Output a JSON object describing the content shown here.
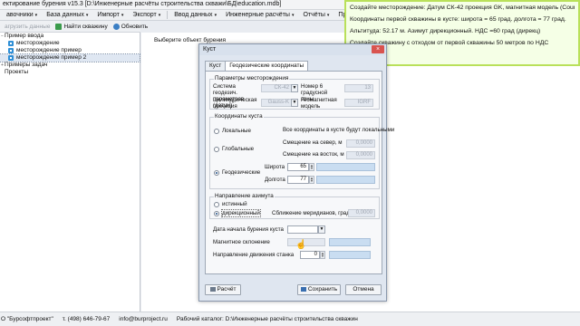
{
  "window": {
    "title": "ектирование бурения v15.3 [D:\\Инженерные расчёты строительства скважи\\БД\\education.mdb]"
  },
  "menu": [
    {
      "label": "авочники",
      "caret": "▾"
    },
    {
      "label": "База данных",
      "caret": "▾"
    },
    {
      "label": "Импорт",
      "caret": "▾"
    },
    {
      "label": "Экспорт",
      "caret": "▾"
    },
    {
      "label": "Ввод данных",
      "caret": "▾"
    },
    {
      "label": "Инженерные расчёты",
      "caret": "▾"
    },
    {
      "label": "Отчёты",
      "caret": "▾"
    },
    {
      "label": "Проект на строительс",
      "caret": ""
    }
  ],
  "toolbar": {
    "unload_label": "агрузить данные",
    "find_well_label": "Найти скважину",
    "refresh_label": "Обновить"
  },
  "tree": {
    "items": [
      {
        "label": "Пример ввода",
        "level": 0,
        "toggle": "−",
        "icon": false
      },
      {
        "label": "месторождение",
        "level": 1,
        "toggle": "",
        "icon": true
      },
      {
        "label": "месторождение пример",
        "level": 1,
        "toggle": "",
        "icon": true
      },
      {
        "label": "месторождение пример 2",
        "level": 1,
        "toggle": "",
        "icon": true,
        "selected": true
      },
      {
        "label": "Примеры задач",
        "level": 0,
        "toggle": "+",
        "icon": false
      },
      {
        "label": "Проекты",
        "level": 0,
        "toggle": "",
        "icon": false
      }
    ]
  },
  "main": {
    "prompt": "Выберите объект бурения"
  },
  "status": {
    "company": "О \"Бурсофтпроект\"",
    "phone": "т. (498) 646-79-67",
    "email": "info@burproject.ru",
    "workdir": "Рабочий каталог: D:\\Инженерные расчёты строительства скважин"
  },
  "note": {
    "lines": [
      "Создайте месторождение: Датум СК-42 проекция GK, магнитная модель (Country)",
      "Координаты первой скважины в кусте: широта = 65 град.  долгота = 77 град.",
      "Альтитуда: 52.17 м. Азимут дирекционный. НДС =60 град (дирекц)",
      "Создайте скважину с отходом от первой скважины 50 метров по НДС"
    ]
  },
  "dialog": {
    "title": "Куст",
    "close_icon": "×",
    "tabs": [
      "Куст",
      "Геодезические координаты"
    ],
    "params_group": {
      "title": "Параметры месторождения",
      "system_label": "Система геодезич. параметров (датум)",
      "system_value": "СК-42",
      "zone_label": "Номер 6 градусной зоны",
      "zone_value": "13",
      "projection_label": "Цилиндрическая проекция",
      "projection_value": "Gauss-K",
      "geomag_label": "Геомагнитная модель",
      "geomag_value": "IGRF"
    },
    "coords_group": {
      "title": "Координаты куста",
      "local_label": "Локальные",
      "local_hint": "Все координаты в кусте будут локальными",
      "global_label": "Глобальные",
      "north_label": "Смещение на север, м",
      "north_value": "0,0000",
      "east_label": "Смещение на восток, м",
      "east_value": "0,0000",
      "geodetic_label": "Геодезические",
      "lat_label": "Широта",
      "lat_value": "65",
      "lon_label": "Долгота",
      "lon_value": "77",
      "selected": "geodetic"
    },
    "azimuth_group": {
      "title": "Направление азимута",
      "true_label": "истинный",
      "grid_label": "дирекционный",
      "convergence_label": "Сближение меридианов, град",
      "convergence_value": "0,0000",
      "selected": "grid"
    },
    "fields": {
      "start_date_label": "Дата начала бурения куста",
      "magdecl_label": "Магнитное склонение",
      "rig_dir_label": "Направление движения станка",
      "rig_dir_value": "0"
    },
    "buttons": {
      "calc": "Расчёт",
      "save": "Сохранить",
      "cancel": "Отмена"
    }
  }
}
